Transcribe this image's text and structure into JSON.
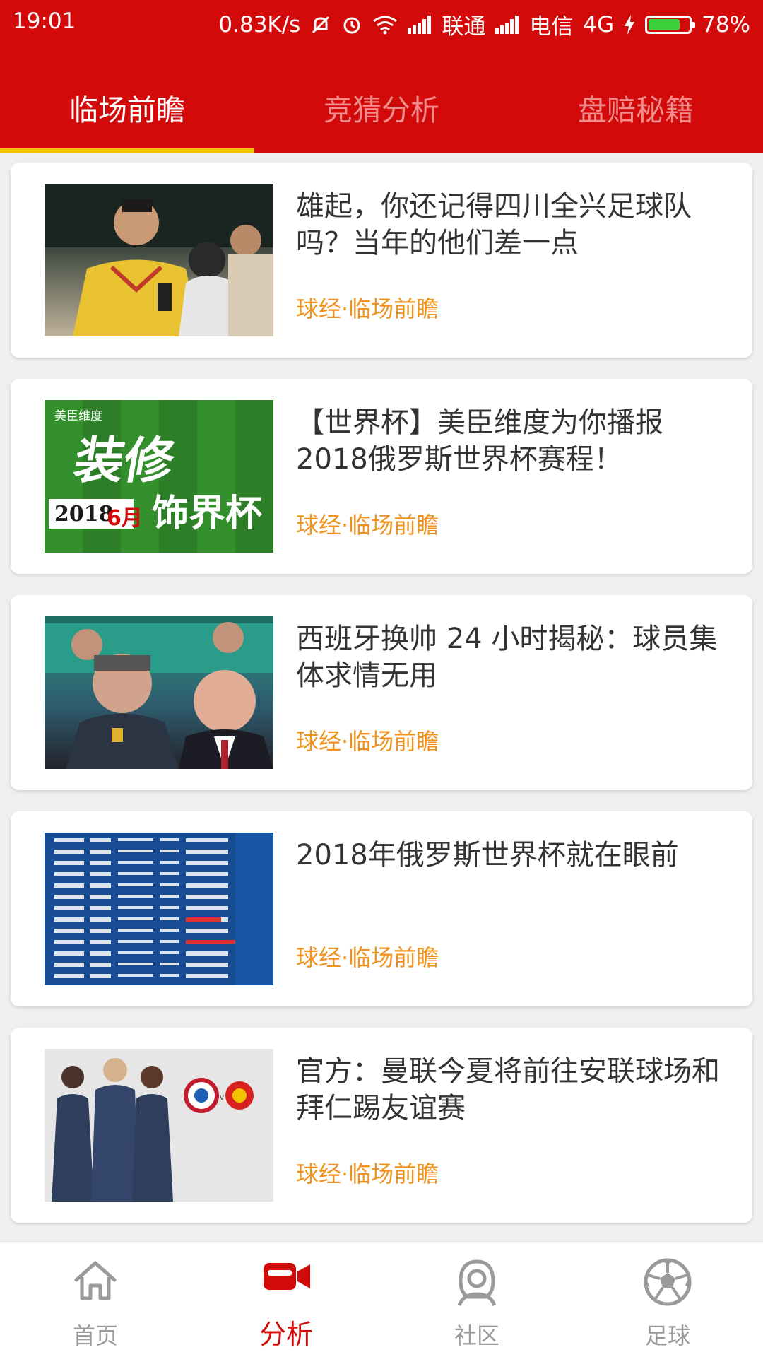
{
  "status_bar": {
    "time": "19:01",
    "speed": "0.83K/s",
    "carrier1": "联通",
    "carrier2": "电信",
    "network": "4G",
    "battery": "78%",
    "battery_level": 0.78,
    "icons": [
      "mute-icon",
      "alarm-icon",
      "wifi-icon",
      "signal-icon",
      "charging-icon",
      "battery-icon"
    ]
  },
  "tabs": [
    {
      "label": "临场前瞻",
      "active": true
    },
    {
      "label": "竞猜分析",
      "active": false
    },
    {
      "label": "盘赔秘籍",
      "active": false
    }
  ],
  "articles": [
    {
      "title": "雄起，你还记得四川全兴足球队吗？当年的他们差一点",
      "meta": "球经·临场前瞻"
    },
    {
      "title": "【世界杯】美臣维度为你播报2018俄罗斯世界杯赛程！",
      "meta": "球经·临场前瞻"
    },
    {
      "title": "西班牙换帅 24 小时揭秘：球员集体求情无用",
      "meta": "球经·临场前瞻"
    },
    {
      "title": "2018年俄罗斯世界杯就在眼前",
      "meta": "球经·临场前瞻"
    },
    {
      "title": "官方：曼联今夏将前往安联球场和拜仁踢友谊赛",
      "meta": "球经·临场前瞻"
    }
  ],
  "thumb2": {
    "brand": "美臣维度",
    "line1": "装修",
    "line2": "饰界杯",
    "date": "2018",
    "month": "6月"
  },
  "bottom_nav": [
    {
      "label": "首页",
      "icon": "home-icon",
      "active": false
    },
    {
      "label": "分析",
      "icon": "video-camera-icon",
      "active": true
    },
    {
      "label": "社区",
      "icon": "community-icon",
      "active": false
    },
    {
      "label": "足球",
      "icon": "soccer-ball-icon",
      "active": false
    }
  ],
  "colors": {
    "header": "#d20a0a",
    "tab_indicator": "#f2c400",
    "meta_text": "#f0921c",
    "nav_active": "#d20a0a",
    "nav_inactive": "#9a9a9a"
  }
}
